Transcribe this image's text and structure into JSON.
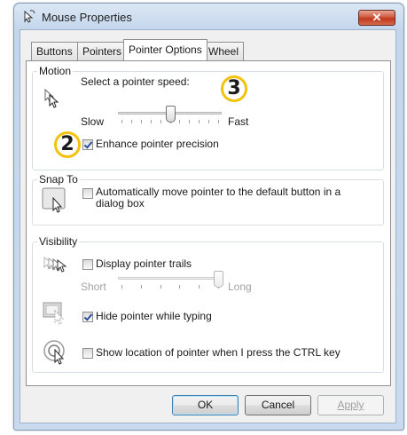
{
  "window": {
    "title": "Mouse Properties",
    "close_label": "✕",
    "close_icon": "close-icon",
    "title_icon": "mouse-icon"
  },
  "tabs": [
    {
      "label": "Buttons",
      "active": false
    },
    {
      "label": "Pointers",
      "active": false
    },
    {
      "label": "Pointer Options",
      "active": true
    },
    {
      "label": "Wheel",
      "active": false
    }
  ],
  "motion": {
    "group_label": "Motion",
    "speed_label": "Select a pointer speed:",
    "slow_label": "Slow",
    "fast_label": "Fast",
    "speed_level": 0.5,
    "precision_label": "Enhance pointer precision",
    "precision_checked": true
  },
  "snap_to": {
    "group_label": "Snap To",
    "label": "Automatically move pointer to the default button in a dialog box",
    "checked": false
  },
  "visibility": {
    "group_label": "Visibility",
    "trails_label": "Display pointer trails",
    "trails_checked": false,
    "short_label": "Short",
    "long_label": "Long",
    "trail_level": 1.0,
    "hide_label": "Hide pointer while typing",
    "hide_checked": true,
    "ctrl_label": "Show location of pointer when I press the CTRL key",
    "ctrl_checked": false
  },
  "buttons": {
    "ok": "OK",
    "cancel": "Cancel",
    "apply": "Apply"
  },
  "annotations": {
    "badge_2": "2",
    "badge_3": "3"
  },
  "colors": {
    "badge_ring": "#f4c20d",
    "check": "#2b4e9b",
    "close_red": "#c1361c"
  }
}
